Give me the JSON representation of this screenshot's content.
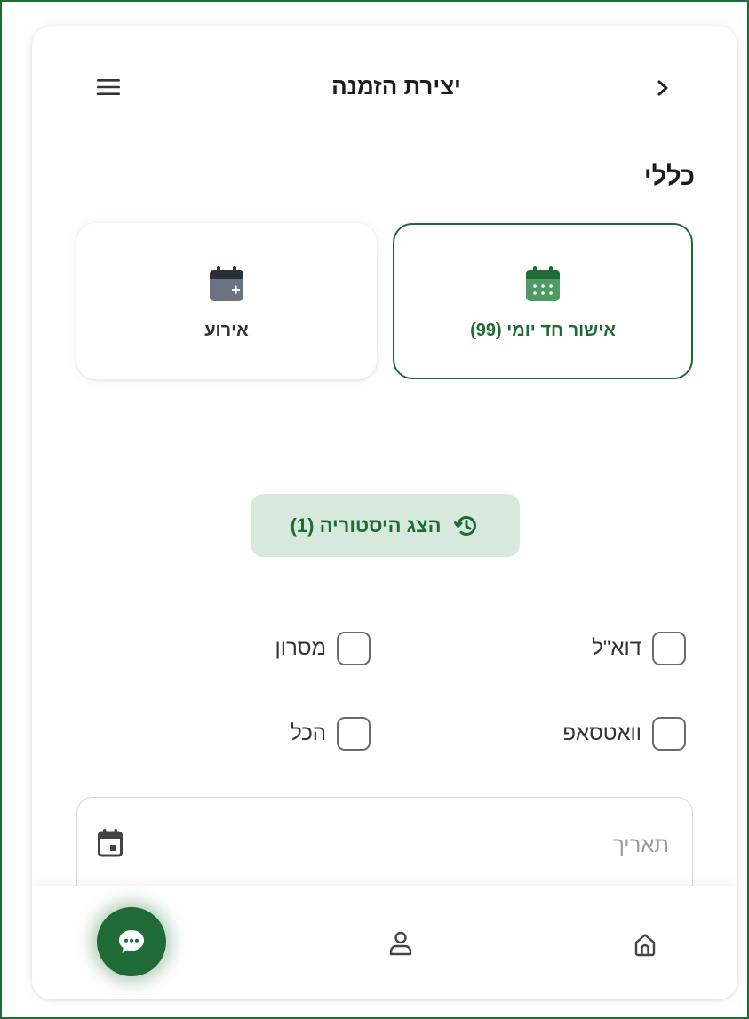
{
  "header": {
    "title": "יצירת הזמנה",
    "menu_icon": "menu-icon",
    "back_icon": "chevron-right-icon"
  },
  "section": {
    "title": "כללי"
  },
  "options": [
    {
      "label": "אישור חד יומי (99)",
      "icon": "calendar-grid-icon",
      "selected": true
    },
    {
      "label": "אירוע",
      "icon": "calendar-plus-icon",
      "selected": false
    }
  ],
  "history_button": {
    "label": "הצג היסטוריה (1)",
    "icon": "history-icon"
  },
  "channels": {
    "email": "דוא\"ל",
    "sms": "מסרון",
    "whatsapp": "וואטסאפ",
    "all": "הכל"
  },
  "date_field": {
    "placeholder": "תאריך",
    "icon": "calendar-icon"
  },
  "bottom_nav": {
    "items": [
      "home-icon",
      "user-icon",
      "chat-icon"
    ]
  },
  "colors": {
    "accent": "#1f6b35",
    "accent_light": "#d7e8dc",
    "event_icon": "#6b7280"
  }
}
